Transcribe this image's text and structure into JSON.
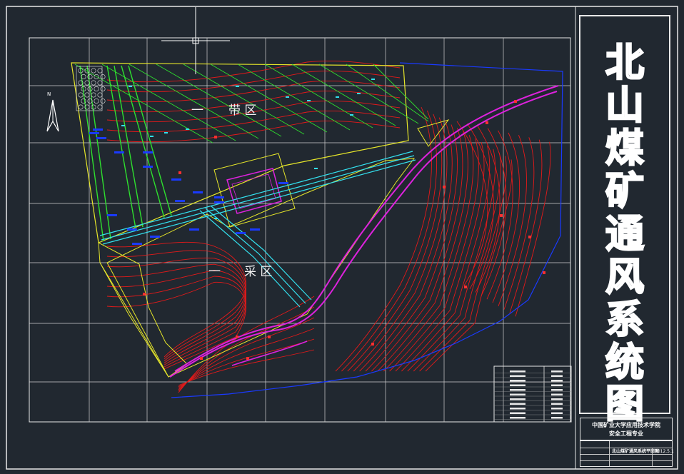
{
  "drawing": {
    "title_chars": [
      "北",
      "山",
      "煤",
      "矿",
      "通",
      "风",
      "系",
      "统",
      "图"
    ],
    "area_labels": {
      "upper_part1": "一",
      "upper_part2": "带 区",
      "lower_part1": "一",
      "lower_part2": "采 区"
    },
    "north_label": "N",
    "title_block": {
      "school_line1": "中国矿业大学应用技术学院",
      "school_line2": "安全工程专业",
      "drawing_name": "北山煤矿通风系统平面图",
      "date": "2012.5.1"
    },
    "colors": {
      "background": "#212830",
      "frame": "#e8e8e8",
      "contour": "#e31a1a",
      "roadway_main": "#dd22dd",
      "roadway_cyan": "#33e0ee",
      "boundary": "#e6e62a",
      "panel_green": "#2ee02e",
      "marker_blue": "#1a3aff"
    }
  }
}
